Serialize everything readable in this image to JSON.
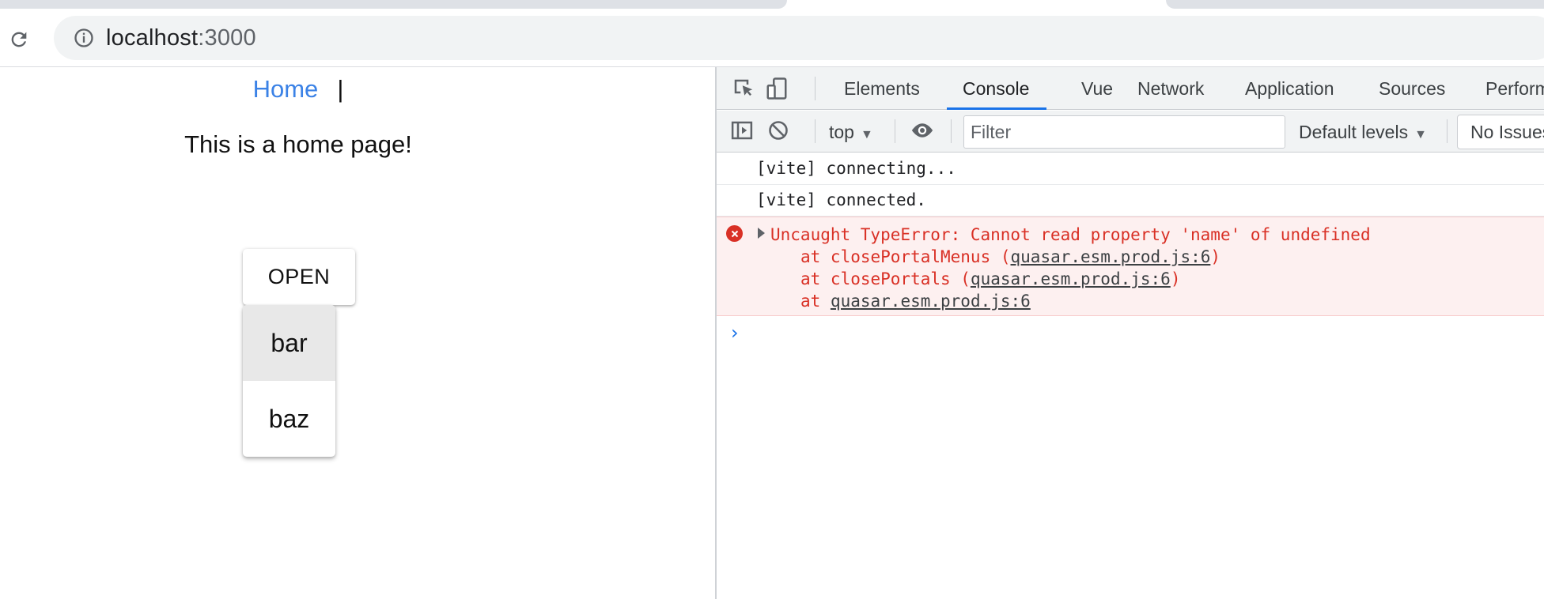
{
  "browser": {
    "reload_icon": "reload-icon",
    "info_icon": "info-icon",
    "url_host": "localhost",
    "url_port": ":3000"
  },
  "page": {
    "nav_link": "Home",
    "nav_separator": "|",
    "message": "This is a home page!",
    "open_button": "OPEN",
    "menu_items": [
      "bar",
      "baz"
    ]
  },
  "devtools": {
    "tabs": [
      "Elements",
      "Console",
      "Vue",
      "Network",
      "Application",
      "Sources",
      "Performance"
    ],
    "active_tab": "Console",
    "context": "top",
    "filter_placeholder": "Filter",
    "levels": "Default levels",
    "issues": "No Issues",
    "logs": [
      "[vite] connecting...",
      "[vite] connected."
    ],
    "error": {
      "message": "Uncaught TypeError: Cannot read property 'name' of undefined",
      "frames": [
        {
          "at": "at closePortalMenus (",
          "link": "quasar.esm.prod.js:6",
          "close": ")"
        },
        {
          "at": "at closePortals (",
          "link": "quasar.esm.prod.js:6",
          "close": ")"
        },
        {
          "at": "at ",
          "link": "quasar.esm.prod.js:6",
          "close": ""
        }
      ]
    },
    "prompt": "›",
    "colors": {
      "accent": "#1a73e8",
      "error": "#d93025",
      "link": "#3b82e6"
    }
  }
}
